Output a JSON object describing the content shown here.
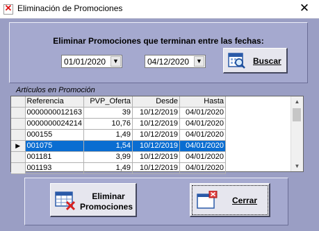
{
  "window": {
    "title": "Eliminación de Promociones",
    "close_glyph": "✕"
  },
  "filter": {
    "heading": "Eliminar Promociones que terminan entre las fechas:",
    "date_from": "01/01/2020",
    "date_to": "04/12/2020",
    "search_label": "Buscar"
  },
  "articles": {
    "group_label": "Artículos en Promoción",
    "columns": [
      "Referencia",
      "PVP_Oferta",
      "Desde",
      "Hasta"
    ],
    "rows": [
      [
        "0000000012163",
        "39",
        "10/12/2019",
        "04/01/2020"
      ],
      [
        "0000000024214",
        "10,76",
        "10/12/2019",
        "04/01/2020"
      ],
      [
        "000155",
        "1,49",
        "10/12/2019",
        "04/01/2020"
      ],
      [
        "001075",
        "1,54",
        "10/12/2019",
        "04/01/2020"
      ],
      [
        "001181",
        "3,99",
        "10/12/2019",
        "04/01/2020"
      ],
      [
        "001193",
        "1,49",
        "10/12/2019",
        "04/01/2020"
      ]
    ],
    "selected_row": 3,
    "current_row_marker": "▶",
    "selection_color": "#0a6dd1"
  },
  "actions": {
    "delete_label_line1": "Eliminar",
    "delete_label_line2": "Promociones",
    "close_label": "Cerrar"
  },
  "icons": {
    "search": "calendar-search-icon",
    "delete": "table-delete-icon",
    "close": "window-close-icon",
    "app": "app-x-icon"
  },
  "colors": {
    "background": "#9a9ec4",
    "panel": "#a5a9cf"
  }
}
